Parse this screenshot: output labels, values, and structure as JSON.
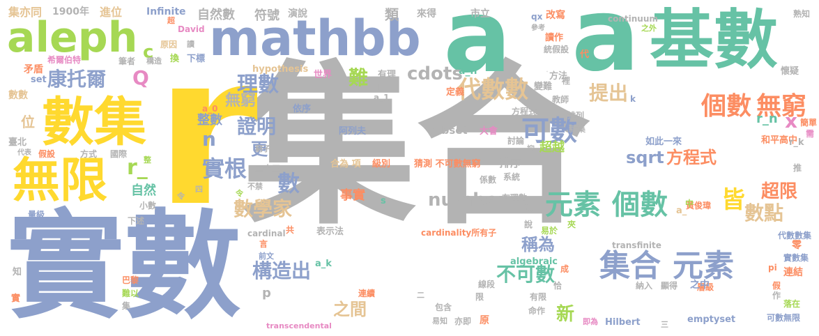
{
  "words": [
    {
      "text": "集合",
      "color": "#b3b3b3"
    },
    {
      "text": "r",
      "color": "#ffd92f"
    },
    {
      "text": "實數",
      "color": "#8da0cb"
    },
    {
      "text": "a",
      "color": "#66c2a5"
    },
    {
      "text": "a",
      "color": "#66c2a5"
    },
    {
      "text": "mathbb",
      "color": "#8da0cb"
    },
    {
      "text": "基數",
      "color": "#66c2a5"
    },
    {
      "text": "aleph",
      "color": "#a6d854"
    },
    {
      "text": "數集",
      "color": "#ffd92f"
    },
    {
      "text": "無限",
      "color": "#ffd92f"
    },
    {
      "text": "集合",
      "color": "#8da0cb"
    },
    {
      "text": "元素",
      "color": "#8da0cb"
    },
    {
      "text": "元素",
      "color": "#66c2a5"
    },
    {
      "text": "個數",
      "color": "#66c2a5"
    },
    {
      "text": "可數",
      "color": "#8da0cb"
    },
    {
      "text": "代數數",
      "color": "#e5c494"
    },
    {
      "text": "個數",
      "color": "#fc8d62"
    },
    {
      "text": "無窮",
      "color": "#fc8d62"
    },
    {
      "text": "理數",
      "color": "#8da0cb"
    },
    {
      "text": "實根",
      "color": "#8da0cb"
    },
    {
      "text": "證明",
      "color": "#8da0cb"
    },
    {
      "text": "康托爾",
      "color": "#8da0cb"
    },
    {
      "text": "數學家",
      "color": "#e5c494"
    },
    {
      "text": "cdots",
      "color": "#b3b3b3"
    },
    {
      "text": "提出",
      "color": "#e5c494"
    },
    {
      "text": "構造出",
      "color": "#8da0cb"
    },
    {
      "text": "不可數",
      "color": "#66c2a5"
    },
    {
      "text": "稱為",
      "color": "#8da0cb"
    },
    {
      "text": "之間",
      "color": "#e5c494"
    },
    {
      "text": "皆",
      "color": "#ffd92f"
    },
    {
      "text": "數點",
      "color": "#e5c494"
    },
    {
      "text": "超限",
      "color": "#fc8d62"
    },
    {
      "text": "number",
      "color": "#b3b3b3"
    },
    {
      "text": "數",
      "color": "#8da0cb"
    },
    {
      "text": "sqrt",
      "color": "#8da0cb"
    },
    {
      "text": "方程式",
      "color": "#fc8d62"
    },
    {
      "text": "r_",
      "color": "#a6d854"
    },
    {
      "text": "Q",
      "color": "#e78ac3"
    },
    {
      "text": "n",
      "color": "#8da0cb"
    },
    {
      "text": "x",
      "color": "#e78ac3"
    },
    {
      "text": "難",
      "color": "#a6d854"
    },
    {
      "text": "更",
      "color": "#8da0cb"
    },
    {
      "text": "新",
      "color": "#a6d854"
    },
    {
      "text": "無窮",
      "color": "#b3b3b3"
    },
    {
      "text": "整數",
      "color": "#8da0cb"
    },
    {
      "text": "自然數",
      "color": "#b3b3b3"
    },
    {
      "text": "符號",
      "color": "#b3b3b3"
    },
    {
      "text": "類",
      "color": "#b3b3b3"
    },
    {
      "text": "c",
      "color": "#a6d854"
    },
    {
      "text": "位",
      "color": "#e5c494"
    },
    {
      "text": "自然",
      "color": "#66c2a5"
    },
    {
      "text": "事實",
      "color": "#fc8d62"
    },
    {
      "text": "排序",
      "color": "#b3b3b3"
    },
    {
      "text": "subset",
      "color": "#b3b3b3"
    },
    {
      "text": "超越",
      "color": "#a6d854"
    },
    {
      "text": "r_n",
      "color": "#66c2a5"
    },
    {
      "text": "集亦同",
      "color": "#e5c494"
    },
    {
      "text": "1900年",
      "color": "#b3b3b3"
    },
    {
      "text": "進位",
      "color": "#e5c494"
    },
    {
      "text": "Infinite",
      "color": "#8da0cb"
    },
    {
      "text": "演說",
      "color": "#b3b3b3"
    },
    {
      "text": "來得",
      "color": "#b3b3b3"
    },
    {
      "text": "市立",
      "color": "#b3b3b3"
    },
    {
      "text": "改寫",
      "color": "#fc8d62"
    },
    {
      "text": "熟知",
      "color": "#b3b3b3"
    },
    {
      "text": "hypothesis",
      "color": "#e5c494"
    },
    {
      "text": "cardinality所有子",
      "color": "#fc8d62"
    },
    {
      "text": "transfinite",
      "color": "#b3b3b3"
    },
    {
      "text": "algebraic",
      "color": "#66c2a5"
    },
    {
      "text": "emptyset",
      "color": "#8da0cb"
    },
    {
      "text": "Hilbert",
      "color": "#8da0cb"
    },
    {
      "text": "transcendental",
      "color": "#e78ac3"
    },
    {
      "text": "continuum",
      "color": "#b3b3b3"
    },
    {
      "text": "cardinal",
      "color": "#b3b3b3"
    },
    {
      "text": "阿列夫",
      "color": "#8da0cb"
    },
    {
      "text": "大會",
      "color": "#e78ac3"
    },
    {
      "text": "如此一來",
      "color": "#8da0cb"
    },
    {
      "text": "和平高中",
      "color": "#fc8d62"
    },
    {
      "text": "猜測 不可數無窮",
      "color": "#fc8d62"
    },
    {
      "text": "合為 項",
      "color": "#e5c494"
    },
    {
      "text": "級別",
      "color": "#fc8d62"
    },
    {
      "text": "表示法",
      "color": "#b3b3b3"
    },
    {
      "text": "希爾伯特",
      "color": "#e78ac3"
    },
    {
      "text": "矛盾",
      "color": "#fc8d62"
    },
    {
      "text": "數數",
      "color": "#e5c494"
    },
    {
      "text": "臺北",
      "color": "#b3b3b3"
    },
    {
      "text": "假設",
      "color": "#fc8d62"
    },
    {
      "text": "方式",
      "color": "#b3b3b3"
    },
    {
      "text": "國際",
      "color": "#b3b3b3"
    },
    {
      "text": "量級",
      "color": "#8da0cb"
    },
    {
      "text": "巴黎",
      "color": "#fc8d62"
    },
    {
      "text": "難以",
      "color": "#a6d854"
    },
    {
      "text": "知",
      "color": "#b3b3b3"
    },
    {
      "text": "實",
      "color": "#fc8d62"
    },
    {
      "text": "集",
      "color": "#b3b3b3"
    },
    {
      "text": "筆者",
      "color": "#b3b3b3"
    },
    {
      "text": "構造",
      "color": "#b3b3b3"
    },
    {
      "text": "下標",
      "color": "#8da0cb"
    },
    {
      "text": "原因",
      "color": "#e5c494"
    },
    {
      "text": "David",
      "color": "#e78ac3"
    },
    {
      "text": "換",
      "color": "#a6d854"
    },
    {
      "text": "set",
      "color": "#8da0cb"
    },
    {
      "text": "世界",
      "color": "#e78ac3"
    },
    {
      "text": "有理",
      "color": "#b3b3b3"
    },
    {
      "text": "a_1",
      "color": "#b3b3b3"
    },
    {
      "text": "a_n",
      "color": "#66c2a5"
    },
    {
      "text": "a_0",
      "color": "#fc8d62"
    },
    {
      "text": "a_k",
      "color": "#66c2a5"
    },
    {
      "text": "a_",
      "color": "#e5c494"
    },
    {
      "text": "r_k",
      "color": "#b3b3b3"
    },
    {
      "text": "定義",
      "color": "#fc8d62"
    },
    {
      "text": "變難",
      "color": "#b3b3b3"
    },
    {
      "text": "教師",
      "color": "#b3b3b3"
    },
    {
      "text": "依序",
      "color": "#8da0cb"
    },
    {
      "text": "代數數集",
      "color": "#8da0cb"
    },
    {
      "text": "實數集",
      "color": "#8da0cb"
    },
    {
      "text": "可數無限",
      "color": "#8da0cb"
    },
    {
      "text": "pi",
      "color": "#fc8d62"
    },
    {
      "text": "落在",
      "color": "#a6d854"
    },
    {
      "text": "連結",
      "color": "#fc8d62"
    },
    {
      "text": "零",
      "color": "#fc8d62"
    },
    {
      "text": "懷疑",
      "color": "#b3b3b3"
    },
    {
      "text": "簡單",
      "color": "#fc8d62"
    },
    {
      "text": "需",
      "color": "#e78ac3"
    },
    {
      "text": "推",
      "color": "#b3b3b3"
    },
    {
      "text": "方法",
      "color": "#b3b3b3"
    },
    {
      "text": "涉及",
      "color": "#b3b3b3"
    },
    {
      "text": "讀作",
      "color": "#fc8d62"
    },
    {
      "text": "統假設",
      "color": "#b3b3b3"
    },
    {
      "text": "參考",
      "color": "#b3b3b3"
    },
    {
      "text": "代",
      "color": "#fc8d62"
    },
    {
      "text": "之外",
      "color": "#a6d854"
    },
    {
      "text": "新集",
      "color": "#b3b3b3"
    },
    {
      "text": "排列",
      "color": "#b3b3b3"
    },
    {
      "text": "方程式",
      "color": "#b3b3b3"
    },
    {
      "text": "討論",
      "color": "#b3b3b3"
    },
    {
      "text": "系統",
      "color": "#b3b3b3"
    },
    {
      "text": "係數",
      "color": "#b3b3b3"
    },
    {
      "text": "有理數",
      "color": "#b3b3b3"
    },
    {
      "text": "黃俊瑋",
      "color": "#fc8d62"
    },
    {
      "text": "易於",
      "color": "#a6d854"
    },
    {
      "text": "夾",
      "color": "#a6d854"
    },
    {
      "text": "層級",
      "color": "#fc8d62"
    },
    {
      "text": "納入",
      "color": "#b3b3b3"
    },
    {
      "text": "顯得",
      "color": "#b3b3b3"
    },
    {
      "text": "之中",
      "color": "#8da0cb"
    },
    {
      "text": "包含",
      "color": "#b3b3b3"
    },
    {
      "text": "亦即",
      "color": "#b3b3b3"
    },
    {
      "text": "原",
      "color": "#fc8d62"
    },
    {
      "text": "命作",
      "color": "#b3b3b3"
    },
    {
      "text": "即為",
      "color": "#e78ac3"
    },
    {
      "text": "易知",
      "color": "#b3b3b3"
    },
    {
      "text": "連續",
      "color": "#fc8d62"
    },
    {
      "text": "前文",
      "color": "#8da0cb"
    },
    {
      "text": "令",
      "color": "#b3b3b3"
    },
    {
      "text": "令",
      "color": "#a6d854"
    },
    {
      "text": "二十三",
      "color": "#b3b3b3"
    },
    {
      "text": "不禁",
      "color": "#b3b3b3"
    },
    {
      "text": "小數",
      "color": "#b3b3b3"
    },
    {
      "text": "下述",
      "color": "#b3b3b3"
    },
    {
      "text": "窮子",
      "color": "#b3b3b3"
    },
    {
      "text": "代表",
      "color": "#b3b3b3"
    },
    {
      "text": "線段",
      "color": "#b3b3b3"
    },
    {
      "text": "限",
      "color": "#b3b3b3"
    },
    {
      "text": "有限",
      "color": "#b3b3b3"
    },
    {
      "text": "成",
      "color": "#fc8d62"
    },
    {
      "text": "恰",
      "color": "#b3b3b3"
    },
    {
      "text": "作",
      "color": "#b3b3b3"
    },
    {
      "text": "假",
      "color": "#fc8d62"
    },
    {
      "text": "共",
      "color": "#fc8d62"
    },
    {
      "text": "言",
      "color": "#fc8d62"
    },
    {
      "text": "說",
      "color": "#b3b3b3"
    },
    {
      "text": "設",
      "color": "#b3b3b3"
    },
    {
      "text": "中",
      "color": "#a6d854"
    },
    {
      "text": "抑",
      "color": "#b3b3b3"
    },
    {
      "text": "k",
      "color": "#8da0cb"
    },
    {
      "text": "qx",
      "color": "#8da0cb"
    },
    {
      "text": "超",
      "color": "#fc8d62"
    },
    {
      "text": "讀",
      "color": "#b3b3b3"
    },
    {
      "text": "裡",
      "color": "#b3b3b3"
    },
    {
      "text": "四",
      "color": "#b3b3b3"
    },
    {
      "text": "三",
      "color": "#b3b3b3"
    },
    {
      "text": "二",
      "color": "#b3b3b3"
    },
    {
      "text": "整",
      "color": "#a6d854"
    },
    {
      "text": "p",
      "color": "#b3b3b3"
    },
    {
      "text": "s",
      "color": "#66c2a5"
    },
    {
      "text": "ll",
      "color": "#b3b3b3"
    }
  ]
}
